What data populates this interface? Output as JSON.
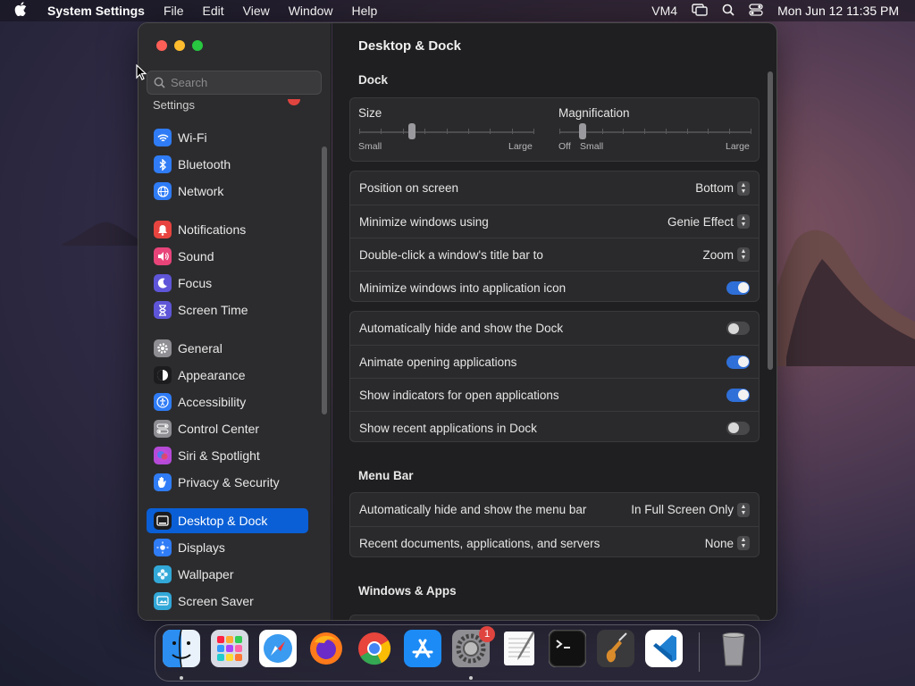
{
  "menubar": {
    "app_name": "System Settings",
    "menus": [
      "File",
      "Edit",
      "View",
      "Window",
      "Help"
    ],
    "status_text": "VM4",
    "clock": "Mon Jun 12  11:35 PM"
  },
  "sidebar": {
    "search_placeholder": "Search",
    "partial_item": "Settings",
    "items": [
      {
        "label": "Wi-Fi",
        "icon": "wifi-icon",
        "color": "#2f7cf6"
      },
      {
        "label": "Bluetooth",
        "icon": "bluetooth-icon",
        "color": "#2f7cf6"
      },
      {
        "label": "Network",
        "icon": "globe-icon",
        "color": "#2f7cf6"
      },
      {
        "label": "Notifications",
        "icon": "bell-icon",
        "color": "#e8443f"
      },
      {
        "label": "Sound",
        "icon": "speaker-icon",
        "color": "#e8447a"
      },
      {
        "label": "Focus",
        "icon": "moon-icon",
        "color": "#5e55d8"
      },
      {
        "label": "Screen Time",
        "icon": "hourglass-icon",
        "color": "#5e55d8"
      },
      {
        "label": "General",
        "icon": "gear-icon",
        "color": "#8e8e93"
      },
      {
        "label": "Appearance",
        "icon": "appearance-icon",
        "color": "#1c1c1e"
      },
      {
        "label": "Accessibility",
        "icon": "accessibility-icon",
        "color": "#2f7cf6"
      },
      {
        "label": "Control Center",
        "icon": "control-center-icon",
        "color": "#8e8e93"
      },
      {
        "label": "Siri & Spotlight",
        "icon": "siri-icon",
        "color": "#b54ad8"
      },
      {
        "label": "Privacy & Security",
        "icon": "hand-icon",
        "color": "#2f7cf6"
      },
      {
        "label": "Desktop & Dock",
        "icon": "dock-icon",
        "color": "#1c1c1e",
        "selected": true
      },
      {
        "label": "Displays",
        "icon": "sun-icon",
        "color": "#2f7cf6"
      },
      {
        "label": "Wallpaper",
        "icon": "flower-icon",
        "color": "#32a8d8"
      },
      {
        "label": "Screen Saver",
        "icon": "screensaver-icon",
        "color": "#32a8d8"
      }
    ]
  },
  "main": {
    "title": "Desktop & Dock",
    "dock_section": "Dock",
    "size": {
      "label": "Size",
      "min_label": "Small",
      "max_label": "Large",
      "value_fraction": 0.3
    },
    "magnification": {
      "label": "Magnification",
      "off_label": "Off",
      "min_label": "Small",
      "max_label": "Large",
      "value_fraction": 0.0
    },
    "settings_group1": [
      {
        "label": "Position on screen",
        "value": "Bottom",
        "type": "popup"
      },
      {
        "label": "Minimize windows using",
        "value": "Genie Effect",
        "type": "popup"
      },
      {
        "label": "Double-click a window's title bar to",
        "value": "Zoom",
        "type": "popup"
      },
      {
        "label": "Minimize windows into application icon",
        "on": true,
        "type": "toggle"
      }
    ],
    "settings_group2": [
      {
        "label": "Automatically hide and show the Dock",
        "on": false,
        "type": "toggle"
      },
      {
        "label": "Animate opening applications",
        "on": true,
        "type": "toggle"
      },
      {
        "label": "Show indicators for open applications",
        "on": true,
        "type": "toggle"
      },
      {
        "label": "Show recent applications in Dock",
        "on": false,
        "type": "toggle"
      }
    ],
    "menubar_section": "Menu Bar",
    "menubar_group": [
      {
        "label": "Automatically hide and show the menu bar",
        "value": "In Full Screen Only",
        "type": "popup"
      },
      {
        "label": "Recent documents, applications, and servers",
        "value": "None",
        "type": "popup"
      }
    ],
    "windows_section": "Windows & Apps"
  },
  "dock": {
    "apps": [
      {
        "name": "Finder",
        "icon": "finder-icon",
        "running": true
      },
      {
        "name": "Launchpad",
        "icon": "launchpad-icon",
        "running": false
      },
      {
        "name": "Safari",
        "icon": "safari-icon",
        "running": false
      },
      {
        "name": "Firefox",
        "icon": "firefox-icon",
        "running": false
      },
      {
        "name": "Chrome",
        "icon": "chrome-icon",
        "running": false
      },
      {
        "name": "App Store",
        "icon": "app-store-icon",
        "running": false
      },
      {
        "name": "System Settings",
        "icon": "system-settings-icon",
        "running": true,
        "badge": "1"
      },
      {
        "name": "TextEdit",
        "icon": "textedit-icon",
        "running": false
      },
      {
        "name": "Terminal",
        "icon": "terminal-icon",
        "running": false
      },
      {
        "name": "GarageBand",
        "icon": "garageband-icon",
        "running": false
      },
      {
        "name": "VS Code",
        "icon": "vscode-icon",
        "running": false
      },
      {
        "name": "Trash",
        "icon": "trash-icon",
        "running": false
      }
    ]
  }
}
